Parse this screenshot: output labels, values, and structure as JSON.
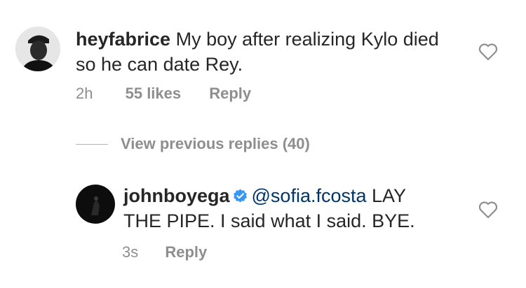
{
  "comment": {
    "username": "heyfabrice",
    "text": "My boy after realizing Kylo died so he can date Rey.",
    "time": "2h",
    "likes": "55 likes",
    "reply_label": "Reply",
    "icon": "heart-outline-icon"
  },
  "view_replies": {
    "label": "View previous replies (40)"
  },
  "reply": {
    "username": "johnboyega",
    "verified": true,
    "mention": "@sofia.fcosta",
    "text": "LAY THE PIPE. I said what I said. BYE.",
    "time": "3s",
    "reply_label": "Reply",
    "icon": "heart-outline-icon"
  },
  "colors": {
    "text": "#262626",
    "muted": "#8e8e8e",
    "mention": "#003569",
    "verified": "#3897f0"
  }
}
